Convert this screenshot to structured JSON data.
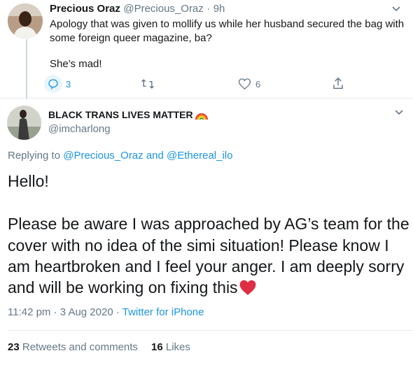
{
  "parent_tweet": {
    "author_name": "Precious Oraz",
    "author_handle": "@Precious_Oraz",
    "separator": "·",
    "time": "9h",
    "text_line1": "Apology that was given to mollify us while her husband secured the bag with",
    "text_line2": "some foreign queer magazine, ba?",
    "text_line3": "She's mad!",
    "actions": {
      "reply_count": "3",
      "retweet_count": "",
      "like_count": "6"
    }
  },
  "main_tweet": {
    "author_name": "BLACK TRANS LIVES MATTER",
    "author_handle": "@imcharlong",
    "replying_prefix": "Replying to",
    "reply_user1": "@Precious_Oraz",
    "reply_and": "and",
    "reply_user2": "@Ethereal_ilo",
    "body_line1": "Hello!",
    "body_line2": "Please be aware I was approached by AG’s team for the",
    "body_line3": "cover with no idea of the simi situation! Please know I",
    "body_line4": "am heartbroken and I feel your anger. I am deeply sorry",
    "body_line5": "and will be working on fixing this",
    "timestamp": "11:42 pm · 3 Aug 2020",
    "dot": "·",
    "source": "Twitter for iPhone",
    "stats": {
      "retweets_count": "23",
      "retweets_label": "Retweets and comments",
      "likes_count": "16",
      "likes_label": "Likes"
    }
  },
  "colors": {
    "accent": "#1b95e0",
    "heart": "#e0245e",
    "muted": "#657786"
  }
}
